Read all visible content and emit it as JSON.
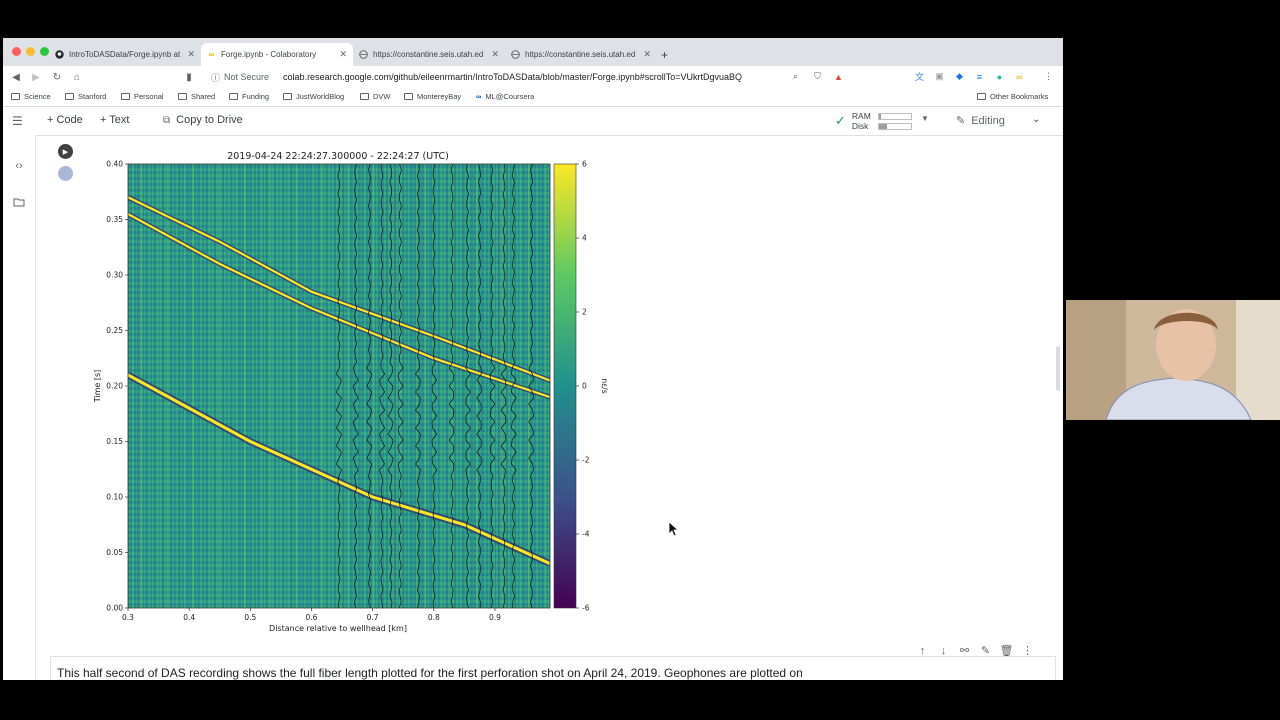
{
  "browser": {
    "tabs": [
      {
        "title": "IntroToDASData/Forge.ipynb at ma",
        "icon": "github-icon",
        "active": false
      },
      {
        "title": "Forge.ipynb - Colaboratory",
        "icon": "colab-icon",
        "active": true
      },
      {
        "title": "https://constantine.seis.utah.ed",
        "icon": "globe-icon",
        "active": false
      },
      {
        "title": "https://constantine.seis.utah.ed",
        "icon": "globe-icon",
        "active": false
      }
    ],
    "new_tab": "+",
    "security_label": "Not Secure",
    "url": "colab.research.google.com/github/eileenrmartin/IntroToDASData/blob/master/Forge.ipynb#scrollTo=VUkrtDgvuaBQ",
    "bookmarks": [
      "Science",
      "Stanford",
      "Personal",
      "Shared",
      "Funding",
      "JustWorldBlog",
      "DVW",
      "MontereyBay",
      "ML@Coursera"
    ],
    "other_bookmarks": "Other Bookmarks"
  },
  "colab": {
    "add_code": "+ Code",
    "add_text": "+ Text",
    "copy_to_drive": "Copy to Drive",
    "ram_label": "RAM",
    "disk_label": "Disk",
    "ram_usage": 0.05,
    "disk_usage": 0.25,
    "editing_label": "Editing"
  },
  "chart_data": {
    "type": "heatmap",
    "title": "2019-04-24 22:24:27.300000 - 22:24:27 (UTC)",
    "xlabel": "Distance relative to wellhead [km]",
    "ylabel": "Time [s]",
    "xlim": [
      0.3,
      0.99
    ],
    "ylim": [
      0.0,
      0.4
    ],
    "x_ticks": [
      "0.3",
      "0.4",
      "0.5",
      "0.6",
      "0.7",
      "0.8",
      "0.9"
    ],
    "y_ticks": [
      "0.00",
      "0.05",
      "0.10",
      "0.15",
      "0.20",
      "0.25",
      "0.30",
      "0.35",
      "0.40"
    ],
    "colorbar": {
      "label": "nε/s",
      "range": [
        -6,
        6
      ],
      "ticks": [
        "6",
        "4",
        "2",
        "0",
        "-2",
        "-4",
        "-6"
      ],
      "colormap": "viridis"
    },
    "arrivals": [
      {
        "name": "",
        "points": [
          [
            0.3,
            0.21
          ],
          [
            0.5,
            0.15
          ],
          [
            0.7,
            0.1
          ],
          [
            0.85,
            0.075
          ],
          [
            0.99,
            0.04
          ]
        ]
      },
      {
        "name": "",
        "points": [
          [
            0.3,
            0.37
          ],
          [
            0.45,
            0.33
          ],
          [
            0.6,
            0.285
          ],
          [
            0.8,
            0.245
          ],
          [
            0.99,
            0.205
          ]
        ]
      },
      {
        "name": "",
        "points": [
          [
            0.3,
            0.355
          ],
          [
            0.45,
            0.31
          ],
          [
            0.6,
            0.27
          ],
          [
            0.8,
            0.225
          ],
          [
            0.99,
            0.19
          ]
        ]
      }
    ],
    "geophone_positions_km": [
      0.645,
      0.672,
      0.695,
      0.715,
      0.73,
      0.745,
      0.775,
      0.8,
      0.83,
      0.855,
      0.875,
      0.895,
      0.915,
      0.93,
      0.96
    ]
  },
  "markdown_cell": {
    "text": "This half second of DAS recording shows the full fiber length plotted for the first perforation shot on April 24, 2019. Geophones are plotted on"
  },
  "colors": {
    "viridis_low": "#440154",
    "viridis_mid": "#21908d",
    "viridis_high": "#fde725",
    "colab_green": "#0f9d58"
  }
}
